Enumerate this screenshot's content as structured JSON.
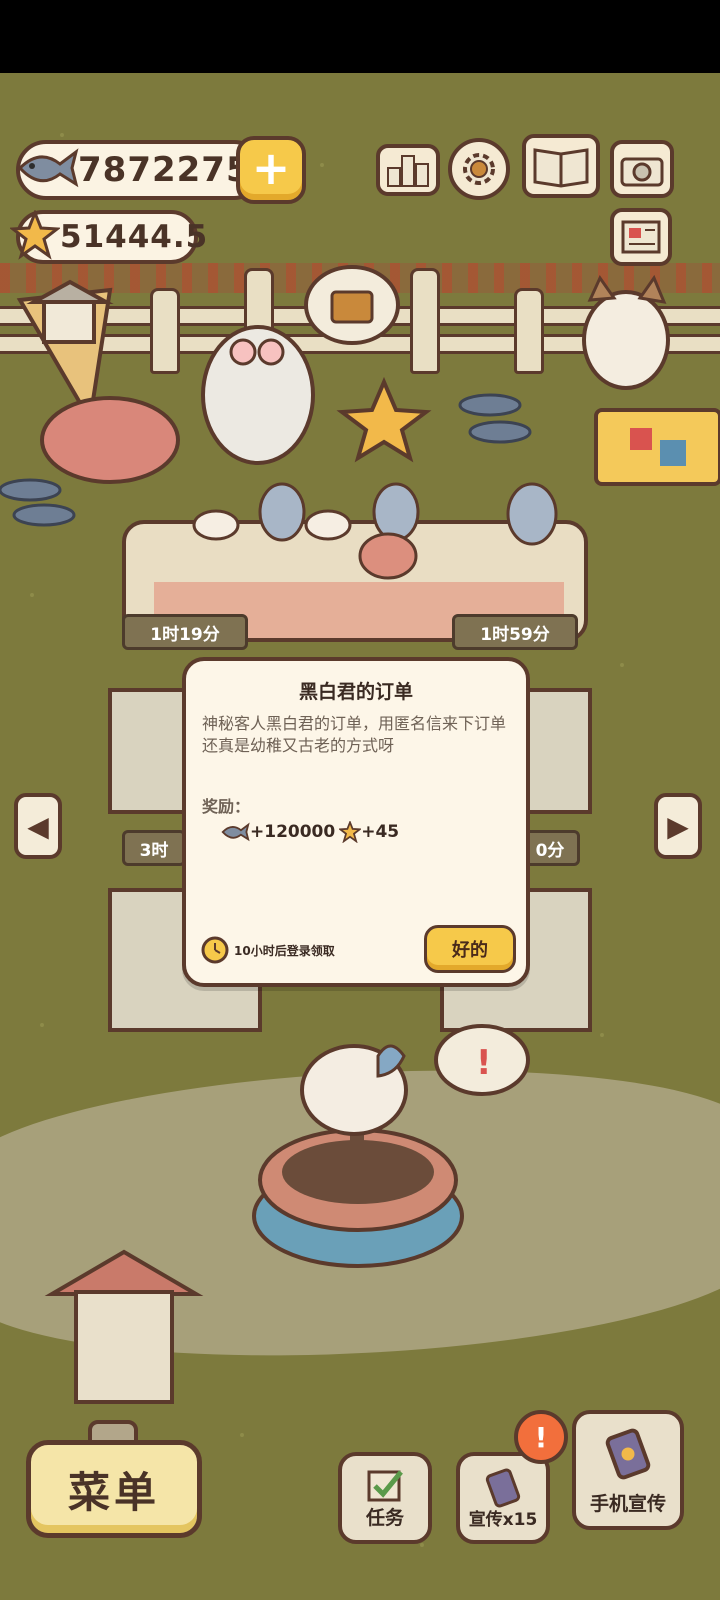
{
  "hud": {
    "fish_count": "7872275",
    "star_count": "51444.5"
  },
  "top_icons": [
    "leaderboard-icon",
    "settings-gear-icon",
    "album-book-icon",
    "camera-icon",
    "newspaper-icon"
  ],
  "timers": {
    "table_left": "1时19分",
    "table_right": "1时59分",
    "mid_left": "3时",
    "mid_right": "0分"
  },
  "dialog": {
    "title": "黑白君的订单",
    "description": "神秘客人黑白君的订单，用匿名信来下订单还真是幼稚又古老的方式呀",
    "reward_label": "奖励：",
    "reward_fish": "+120000",
    "reward_star": "+45",
    "timer_text": "10小时后登录领取",
    "ok_label": "好的"
  },
  "bottom": {
    "menu_label": "菜单",
    "tasks_label": "任务",
    "promo_label": "宣传x15",
    "phone_promo_label": "手机宣传",
    "badge_text": "!"
  },
  "colors": {
    "grass": "#7d7a3d",
    "outline": "#5b3a2c",
    "button_yellow": "#f6c94a",
    "panel": "#fdf6e8"
  }
}
